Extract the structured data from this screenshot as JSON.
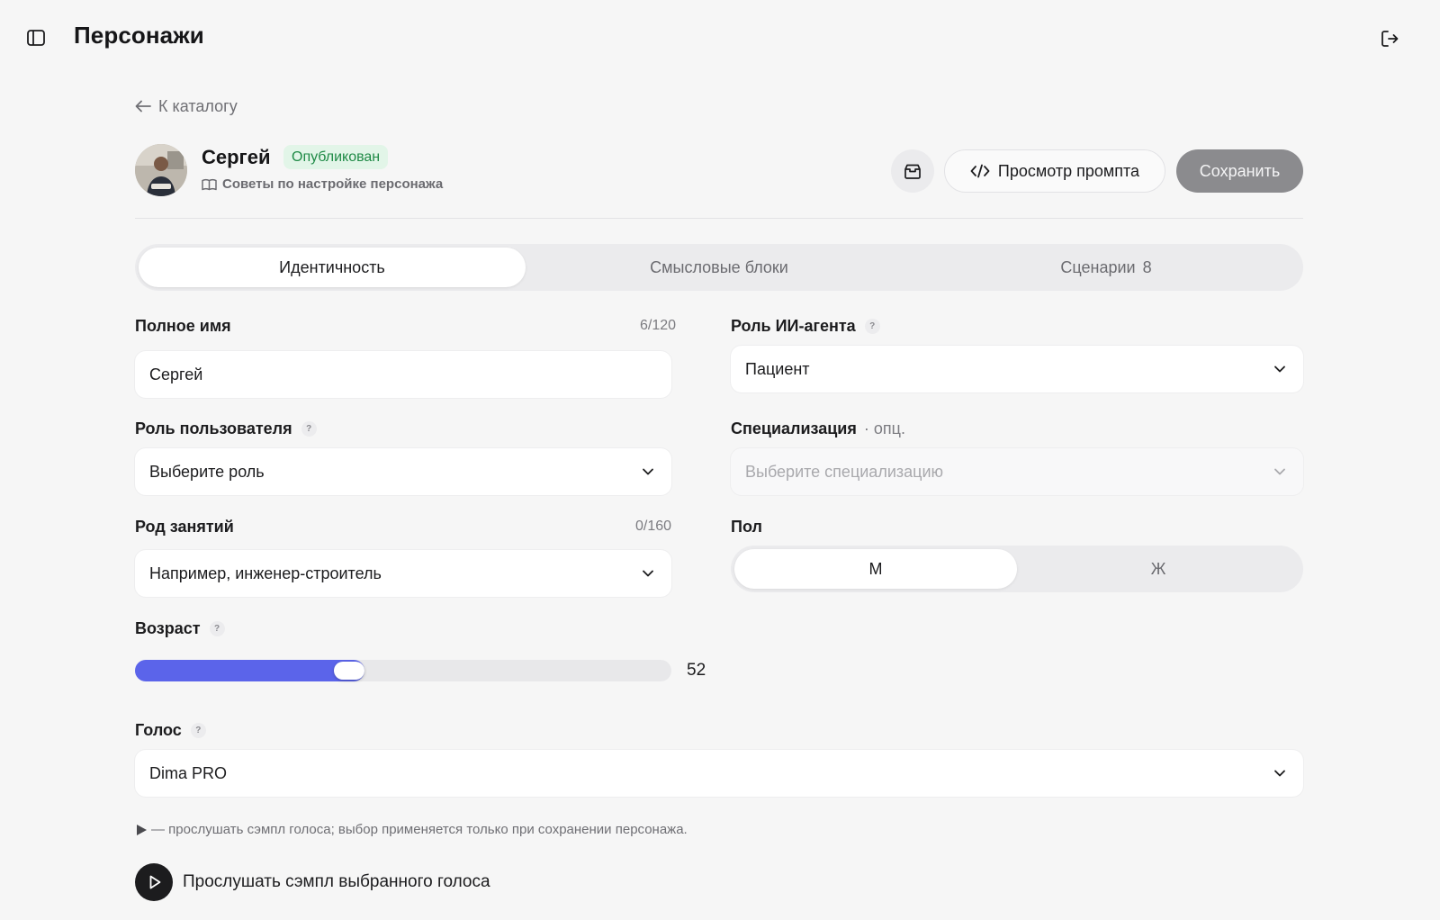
{
  "topbar": {
    "title": "Персонажи",
    "sidebar_toggle_icon": "sidebar-icon",
    "logout_icon": "logout-icon"
  },
  "back": {
    "label": "К каталогу",
    "icon": "arrow-left-icon"
  },
  "character": {
    "name": "Сергей",
    "status": "Опубликован",
    "tips_label": "Советы по настройке персонажа",
    "tips_icon": "book-icon"
  },
  "actions": {
    "archive_icon": "archive-icon",
    "prompt_label": "Просмотр промпта",
    "prompt_icon": "code-icon",
    "save_label": "Сохранить"
  },
  "tabs": [
    {
      "label": "Идентичность",
      "count": "",
      "active": true
    },
    {
      "label": "Смысловые блоки",
      "count": "",
      "active": false
    },
    {
      "label": "Сценарии",
      "count": "8",
      "active": false
    }
  ],
  "form": {
    "full_name": {
      "label": "Полное имя",
      "counter": "6/120",
      "value": "Сергей"
    },
    "ai_role": {
      "label": "Роль ИИ-агента",
      "help": "?",
      "value": "Пациент"
    },
    "user_role": {
      "label": "Роль пользователя",
      "help": "?",
      "value": "Выберите роль"
    },
    "specialization": {
      "label": "Специализация",
      "optional": "· опц.",
      "placeholder": "Выберите специализацию"
    },
    "occupation": {
      "label": "Род занятий",
      "counter": "0/160",
      "placeholder": "Например, инженер-строитель"
    },
    "gender": {
      "label": "Пол",
      "options": [
        "М",
        "Ж"
      ],
      "selected": "М"
    },
    "age": {
      "label": "Возраст",
      "help": "?",
      "value": 52,
      "min": 0,
      "max": 130
    },
    "voice": {
      "label": "Голос",
      "help": "?",
      "value": "Dima PRO",
      "hint": "— прослушать сэмпл голоса; выбор применяется только при сохранении персонажа.",
      "play_label": "Прослушать сэмпл выбранного голоса"
    }
  },
  "colors": {
    "accent": "#5b64ea",
    "badge_bg": "#e2f5e8",
    "badge_text": "#1f8a46",
    "save_disabled": "#8b8b8e"
  }
}
